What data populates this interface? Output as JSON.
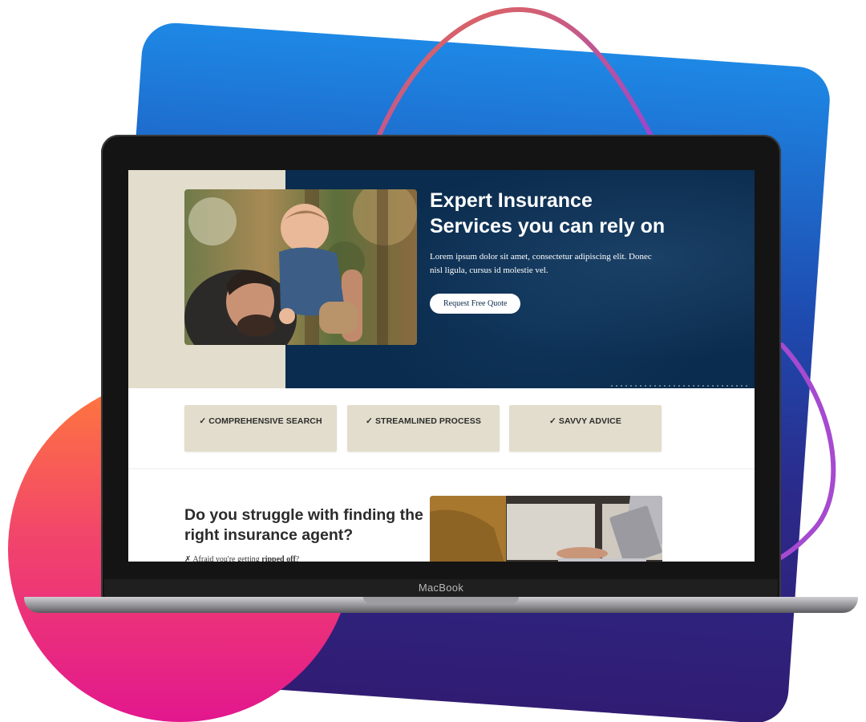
{
  "device": {
    "brand_label": "MacBook"
  },
  "hero": {
    "title": "Expert Insurance Services you can rely on",
    "subtitle": "Lorem ipsum dolor sit amet, consectetur adipiscing elit. Donec nisl ligula, cursus id molestie vel.",
    "cta_label": "Request Free Quote",
    "photo_icon": "family-photo"
  },
  "features": [
    {
      "label": "✓ COMPREHENSIVE SEARCH"
    },
    {
      "label": "✓ STREAMLINED PROCESS"
    },
    {
      "label": "✓ SAVVY ADVICE"
    }
  ],
  "struggle": {
    "title": "Do you struggle with finding the right insurance agent?",
    "item_prefix": "✗ Afraid you're getting ",
    "item_emphasis": "ripped off",
    "item_suffix": "?",
    "photo_icon": "laptop-work-photo"
  },
  "colors": {
    "navy": "#0a2c4e",
    "beige": "#e2ddcc",
    "swoosh_start": "#e86a4e",
    "swoosh_end": "#9b45d0"
  }
}
